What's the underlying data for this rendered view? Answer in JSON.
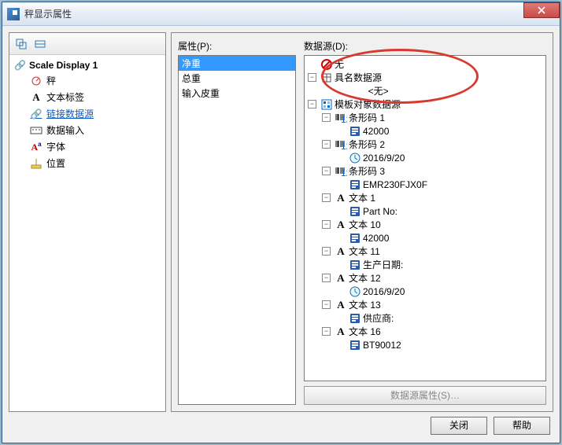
{
  "window": {
    "title": "秤显示属性"
  },
  "left_tree": {
    "root": "Scale Display 1",
    "items": [
      {
        "label": "秤",
        "icon": "scale-icon"
      },
      {
        "label": "文本标签",
        "icon": "text-a-icon"
      },
      {
        "label": "链接数据源",
        "icon": "link-icon",
        "selected": true
      },
      {
        "label": "数据输入",
        "icon": "keyboard-icon"
      },
      {
        "label": "字体",
        "icon": "font-icon"
      },
      {
        "label": "位置",
        "icon": "ruler-icon"
      }
    ]
  },
  "props": {
    "label": "属性(P):",
    "items": [
      "净重",
      "总重",
      "输入皮重"
    ],
    "selected_index": 0
  },
  "datasource": {
    "label": "数据源(D):",
    "none_label": "无",
    "named_label": "具名数据源",
    "named_placeholder": "<无>",
    "template_label": "模板对象数据源",
    "template_children": [
      {
        "label": "条形码 1",
        "icon": "barcode-icon",
        "child": {
          "label": "42000",
          "icon": "embed-icon"
        }
      },
      {
        "label": "条形码 2",
        "icon": "barcode-icon",
        "child": {
          "label": "2016/9/20",
          "icon": "clock-icon"
        }
      },
      {
        "label": "条形码 3",
        "icon": "barcode-icon",
        "child": {
          "label": "EMR230FJX0F",
          "icon": "embed-icon"
        }
      },
      {
        "label": "文本 1",
        "icon": "text-a-icon",
        "child": {
          "label": "Part No:",
          "icon": "embed-icon"
        }
      },
      {
        "label": "文本 10",
        "icon": "text-a-icon",
        "child": {
          "label": "42000",
          "icon": "embed-icon"
        }
      },
      {
        "label": "文本 11",
        "icon": "text-a-icon",
        "child": {
          "label": "生产日期:",
          "icon": "embed-icon"
        }
      },
      {
        "label": "文本 12",
        "icon": "text-a-icon",
        "child": {
          "label": "2016/9/20",
          "icon": "clock-icon"
        }
      },
      {
        "label": "文本 13",
        "icon": "text-a-icon",
        "child": {
          "label": "供应商:",
          "icon": "embed-icon"
        }
      },
      {
        "label": "文本 16",
        "icon": "text-a-icon",
        "child": {
          "label": "BT90012",
          "icon": "embed-icon"
        }
      }
    ],
    "props_button": "数据源属性(S)…"
  },
  "footer": {
    "close": "关闭",
    "help": "帮助"
  }
}
